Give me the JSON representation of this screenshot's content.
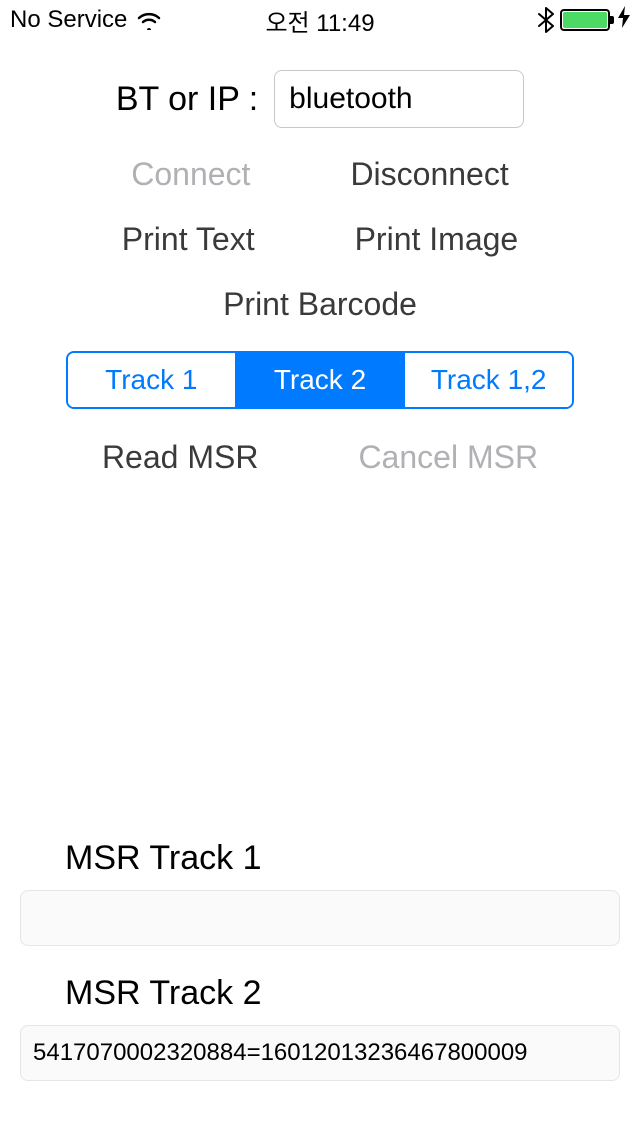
{
  "status": {
    "carrier": "No Service",
    "time": "오전 11:49"
  },
  "form": {
    "label": "BT or IP :",
    "value": "bluetooth"
  },
  "buttons": {
    "connect": "Connect",
    "disconnect": "Disconnect",
    "print_text": "Print Text",
    "print_image": "Print Image",
    "print_barcode": "Print Barcode",
    "read_msr": "Read MSR",
    "cancel_msr": "Cancel MSR"
  },
  "segments": {
    "track1": "Track 1",
    "track2": "Track 2",
    "track12": "Track 1,2",
    "selected": "track2"
  },
  "msr": {
    "label1": "MSR Track 1",
    "value1": "",
    "label2": "MSR Track 2",
    "value2": "5417070002320884=16012013236467800009"
  }
}
